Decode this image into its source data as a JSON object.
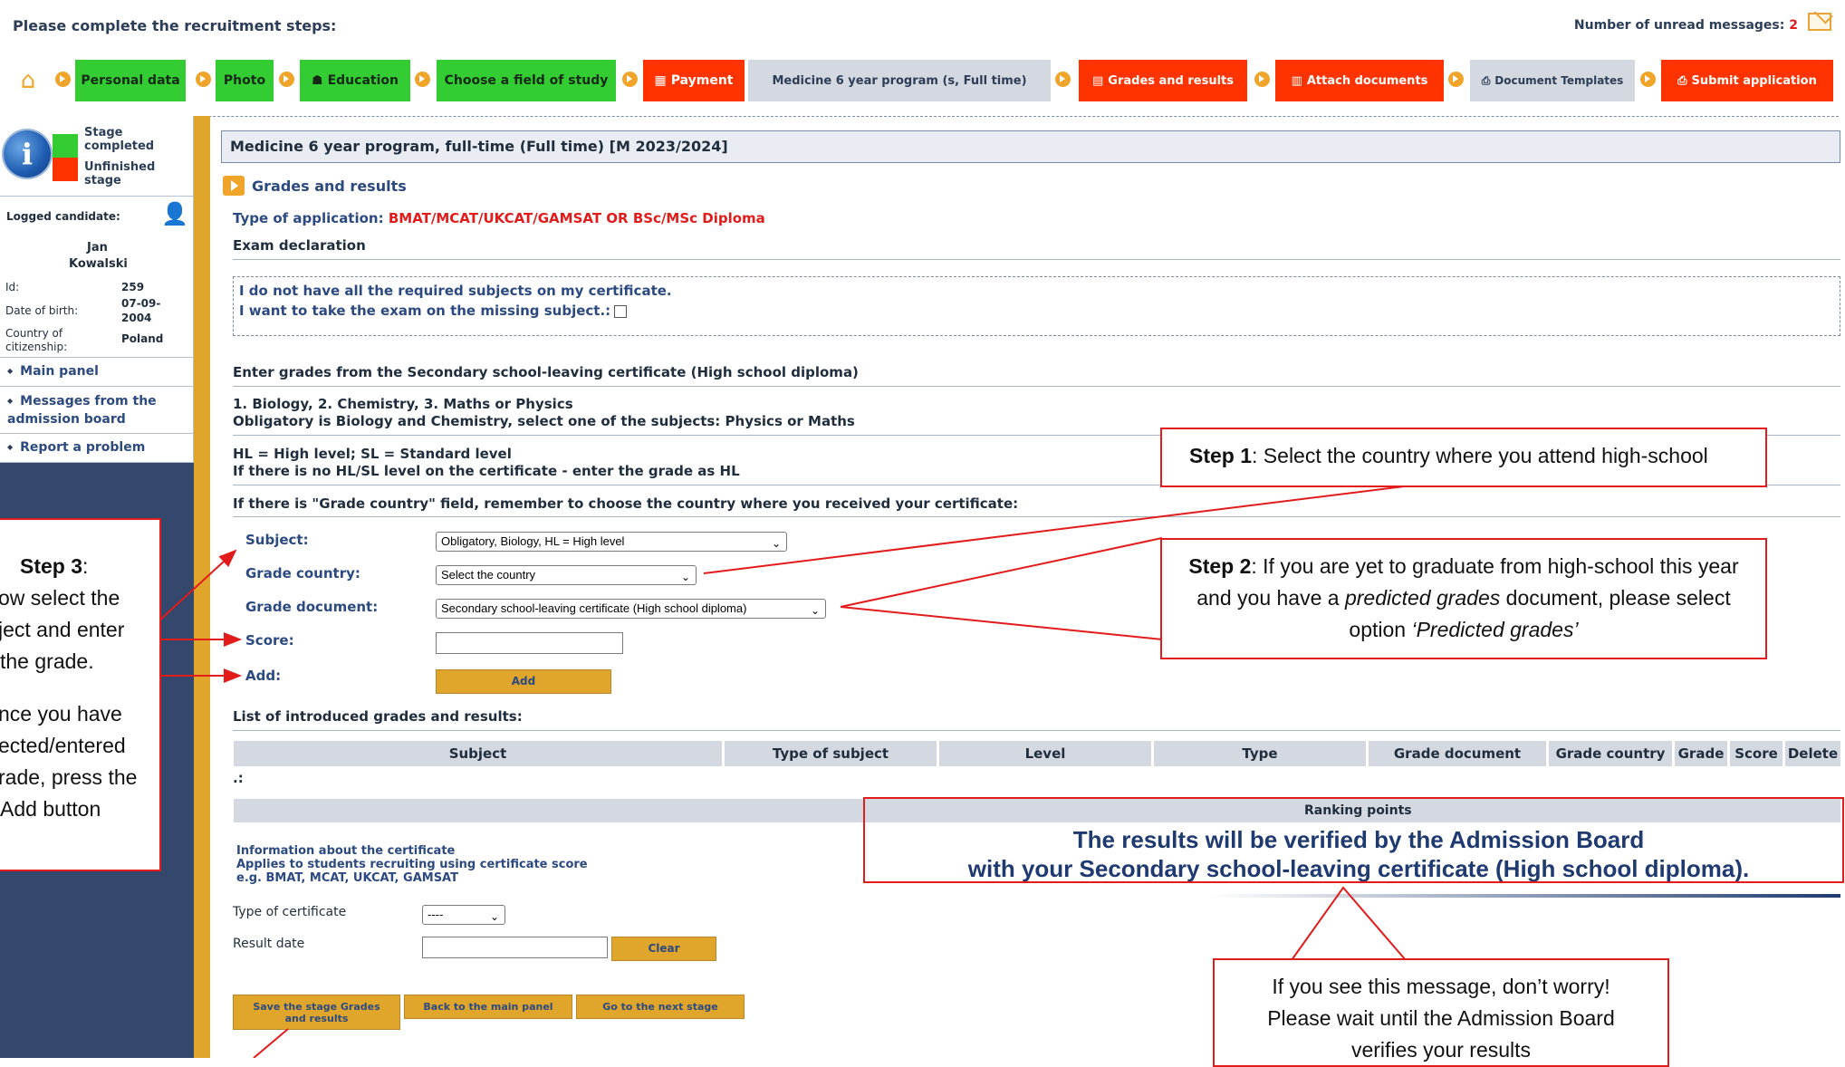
{
  "header": {
    "title": "Please complete the recruitment steps:",
    "unread_label": "Number of unread messages:",
    "unread_count": "2"
  },
  "steps": [
    {
      "label": "Personal data",
      "status": "completed"
    },
    {
      "label": "Photo",
      "status": "completed"
    },
    {
      "label": "Education",
      "status": "completed"
    },
    {
      "label": "Choose a field of study",
      "status": "completed"
    },
    {
      "label": "Payment",
      "status": "unfinished"
    },
    {
      "label": "Medicine 6 year program (s, Full time)",
      "status": "current"
    },
    {
      "label": "Grades and results",
      "status": "unfinished"
    },
    {
      "label": "Attach documents",
      "status": "unfinished"
    },
    {
      "label": "Document Templates",
      "status": "neutral"
    },
    {
      "label": "Submit application",
      "status": "unfinished"
    }
  ],
  "sidebar": {
    "legend_completed": "Stage completed",
    "legend_unfinished": "Unfinished stage",
    "logged_label": "Logged candidate:",
    "candidate_first": "Jan",
    "candidate_last": "Kowalski",
    "id_label": "Id:",
    "id_value": "259",
    "dob_label": "Date of birth:",
    "dob_value_1": "07-09-",
    "dob_value_2": "2004",
    "country_label_1": "Country of",
    "country_label_2": "citizenship:",
    "country_value": "Poland",
    "links": [
      "Main panel",
      "Messages from the admission board",
      "Report a problem"
    ]
  },
  "main": {
    "program_title": "Medicine 6 year program, full-time (Full time) [M 2023/2024]",
    "section_title": "Grades and results",
    "application_type_label": "Type of application:",
    "application_type_value": "BMAT/MCAT/UKCAT/GAMSAT OR BSc/MSc Diploma",
    "exam_declaration": "Exam declaration",
    "exam_line1": "I do not have all the required subjects on my certificate.",
    "exam_line2": "I want to take the exam on the missing subject.:",
    "enter_grades": "Enter grades from the Secondary school-leaving certificate (High school diploma)",
    "subjects_line1": "1. Biology, 2. Chemistry, 3. Maths or Physics",
    "subjects_line2": "Obligatory is Biology and Chemistry, select one of the subjects: Physics or Maths",
    "levels_line1": "HL = High level; SL = Standard level",
    "levels_line2": "If there is no HL/SL level on the certificate - enter the grade as HL",
    "grade_country_note": "If there is \"Grade country\" field, remember to choose the country where you received your certificate:",
    "form": {
      "subject_label": "Subject:",
      "subject_value": "Obligatory, Biology, HL = High level",
      "country_label": "Grade country:",
      "country_value": "Select the country",
      "document_label": "Grade document:",
      "document_value": "Secondary school-leaving certificate (High school diploma)",
      "score_label": "Score:",
      "score_value": "",
      "add_label": "Add:",
      "add_button": "Add"
    },
    "list_title": "List of introduced grades and results:",
    "table_headers": [
      "Subject",
      "Type of subject",
      "Level",
      "Type",
      "Grade document",
      "Grade country",
      "Grade",
      "Score",
      "Delete"
    ],
    "table_empty": ".:",
    "ranking_label": "Ranking points",
    "verify_line1": "The results will be verified by the Admission Board",
    "verify_line2": "with your Secondary school-leaving certificate (High school diploma).",
    "cert_info_1": "Information about the certificate",
    "cert_info_2": "Applies to students recruiting using certificate score",
    "cert_info_3": "e.g. BMAT, MCAT, UKCAT, GAMSAT",
    "cert_type_label": "Type of certificate",
    "cert_type_value": "----",
    "result_date_label": "Result date",
    "result_date_value": "",
    "clear_button": "Clear",
    "save_button": "Save the stage Grades and results",
    "back_button": "Back to the main panel",
    "next_button": "Go to the next stage"
  },
  "annotations": {
    "step1_bold": "Step 1",
    "step1_text": ": Select the country where you attend high-school",
    "step2_bold": "Step 2",
    "step2_text_a": ": If you are yet to graduate from high-school this year and you have a ",
    "step2_italic": "predicted grades",
    "step2_text_b": " document, please select option ",
    "step2_option": "‘Predicted grades’",
    "step3_bold": "Step 3",
    "step3_colon": ":",
    "step3_l1": "ow select the",
    "step3_l2": "ject and enter",
    "step3_l3": "the grade.",
    "step3_l4": "nce you have",
    "step3_l5": "ected/entered",
    "step3_l6": "rade, press the",
    "step3_l7": "Add button",
    "worry_l1": "If you see this message, don’t worry!",
    "worry_l2": "Please wait until the Admission Board",
    "worry_l3": "verifies your results"
  },
  "colors": {
    "completed": "#33cc33",
    "unfinished": "#ff3300",
    "accent": "#e0a52b",
    "sidebar": "#34476c",
    "annotation": "#e21b1b"
  },
  "icons": [
    "home-icon",
    "info-icon",
    "envelope-icon",
    "user-icon",
    "step-arrow-icon"
  ]
}
